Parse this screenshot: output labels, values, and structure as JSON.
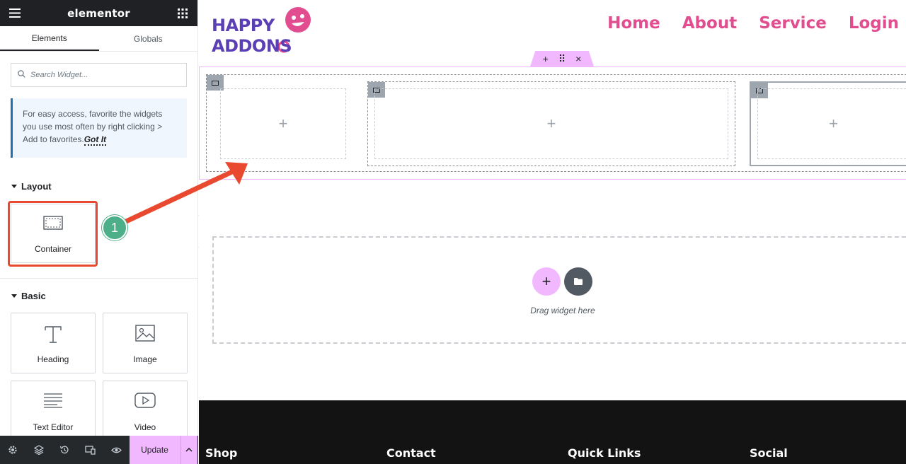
{
  "sidebar": {
    "brand": "elementor",
    "tabs": [
      {
        "label": "Elements"
      },
      {
        "label": "Globals"
      }
    ],
    "search": {
      "placeholder": "Search Widget..."
    },
    "notice": {
      "text": "For easy access, favorite the widgets you use most often by right clicking > Add to favorites.",
      "link": "Got It"
    },
    "layout_title": "Layout",
    "basic_title": "Basic",
    "widgets": {
      "container": "Container",
      "heading": "Heading",
      "image": "Image",
      "text_editor": "Text Editor",
      "video": "Video"
    },
    "footer": {
      "update_label": "Update"
    }
  },
  "canvas": {
    "logo": {
      "line1": "HAPPY",
      "line2": "ADDONS"
    },
    "nav": [
      "Home",
      "About",
      "Service",
      "Login"
    ],
    "handle": {
      "add": "+",
      "move": "⠿",
      "close": "×"
    },
    "columns_add": "+",
    "dropzone": {
      "add": "+",
      "text": "Drag widget here"
    },
    "footer_columns": [
      "Shop",
      "Contact",
      "Quick Links",
      "Social"
    ]
  },
  "annotation": {
    "number": "1"
  },
  "colors": {
    "accent_pink": "#f2b8ff",
    "nav_pink": "#e14d8f",
    "logo_purple": "#5b3fb5",
    "annotation_red": "#e8492f",
    "annotation_green": "#4caf89",
    "dark": "#1f2124"
  }
}
